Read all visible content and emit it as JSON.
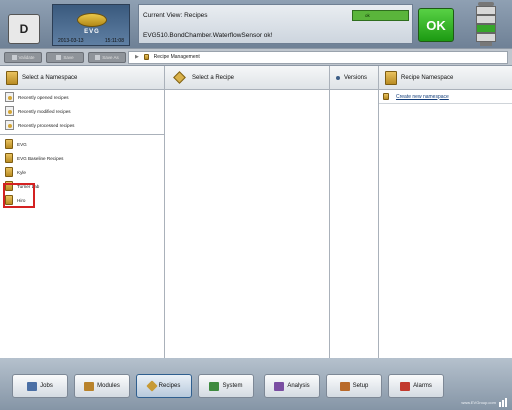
{
  "header": {
    "user_badge": "D",
    "logo_text": "EVG",
    "date": "2013-03-13",
    "time": "15:11:08",
    "current_view": "Current View: Recipes",
    "status_label": "ok",
    "message": "EVG510.BondChamber.WaterflowSensor ok!",
    "ok_button": "OK"
  },
  "toolbar": {
    "buttons": [
      {
        "label": "Validate"
      },
      {
        "label": "Save"
      },
      {
        "label": "Save As"
      }
    ],
    "breadcrumb": "Recipe Management"
  },
  "namespace_panel": {
    "title": "Select a Namespace",
    "recent": [
      {
        "label": "Recently opened recipes"
      },
      {
        "label": "Recently modified recipes"
      },
      {
        "label": "Recently processed recipes"
      }
    ],
    "namespaces": [
      {
        "label": "EVG"
      },
      {
        "label": "EVG Baseline Recipes"
      },
      {
        "label": "Kyle"
      },
      {
        "label": "Turner Lab"
      },
      {
        "label": "Hiro"
      }
    ]
  },
  "recipe_panel": {
    "title": "Select a Recipe"
  },
  "versions_panel": {
    "title": "Versions"
  },
  "recipe_namespace_panel": {
    "title": "Recipe Namespace",
    "create_link": "Create new namespace"
  },
  "bottom_nav": {
    "items": [
      {
        "label": "Jobs",
        "color": "#4a6fa5"
      },
      {
        "label": "Modules",
        "color": "#b9832b"
      },
      {
        "label": "Recipes",
        "color": "#c79a35"
      },
      {
        "label": "System",
        "color": "#3e8a3e"
      },
      {
        "label": "Analysis",
        "color": "#7a4ea2"
      },
      {
        "label": "Setup",
        "color": "#b86a2a"
      },
      {
        "label": "Alarms",
        "color": "#c23a2e"
      }
    ],
    "site": "www.EVGroup.com"
  }
}
